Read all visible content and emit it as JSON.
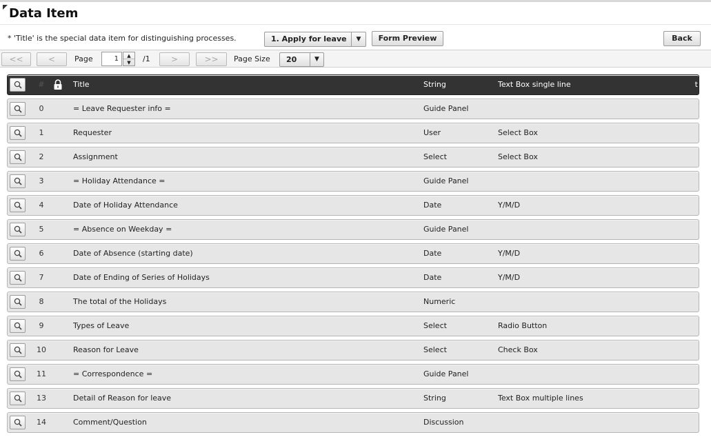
{
  "page": {
    "title": "Data Item",
    "note": "* 'Title' is the special data item for distinguishing processes."
  },
  "toolbar": {
    "process_select": "1. Apply for leave",
    "form_preview_label": "Form Preview",
    "back_label": "Back"
  },
  "pager": {
    "first": "<<",
    "prev": "<",
    "page_label": "Page",
    "page_value": "1",
    "total_pages": "/1",
    "next": ">",
    "last": ">>",
    "page_size_label": "Page Size",
    "page_size": "20"
  },
  "table": {
    "header": {
      "num": "#",
      "title": "Title",
      "type": "String",
      "ui": "Text Box single line",
      "trail": "t"
    },
    "rows": [
      {
        "num": "0",
        "title": "= Leave Requester info =",
        "type": "Guide Panel",
        "ui": ""
      },
      {
        "num": "1",
        "title": "Requester",
        "type": "User",
        "ui": "Select Box"
      },
      {
        "num": "2",
        "title": "Assignment",
        "type": "Select",
        "ui": "Select Box"
      },
      {
        "num": "3",
        "title": "= Holiday Attendance =",
        "type": "Guide Panel",
        "ui": ""
      },
      {
        "num": "4",
        "title": "Date of Holiday Attendance",
        "type": "Date",
        "ui": "Y/M/D"
      },
      {
        "num": "5",
        "title": "= Absence on Weekday =",
        "type": "Guide Panel",
        "ui": ""
      },
      {
        "num": "6",
        "title": "Date of Absence (starting date)",
        "type": "Date",
        "ui": "Y/M/D"
      },
      {
        "num": "7",
        "title": "Date of Ending of Series of Holidays",
        "type": "Date",
        "ui": "Y/M/D"
      },
      {
        "num": "8",
        "title": "The total of the Holidays",
        "type": "Numeric",
        "ui": ""
      },
      {
        "num": "9",
        "title": "Types of Leave",
        "type": "Select",
        "ui": "Radio Button"
      },
      {
        "num": "10",
        "title": "Reason for Leave",
        "type": "Select",
        "ui": "Check Box"
      },
      {
        "num": "11",
        "title": "= Correspondence =",
        "type": "Guide Panel",
        "ui": ""
      },
      {
        "num": "13",
        "title": "Detail of Reason for leave",
        "type": "String",
        "ui": "Text Box multiple lines"
      },
      {
        "num": "14",
        "title": "Comment/Question",
        "type": "Discussion",
        "ui": ""
      }
    ]
  }
}
